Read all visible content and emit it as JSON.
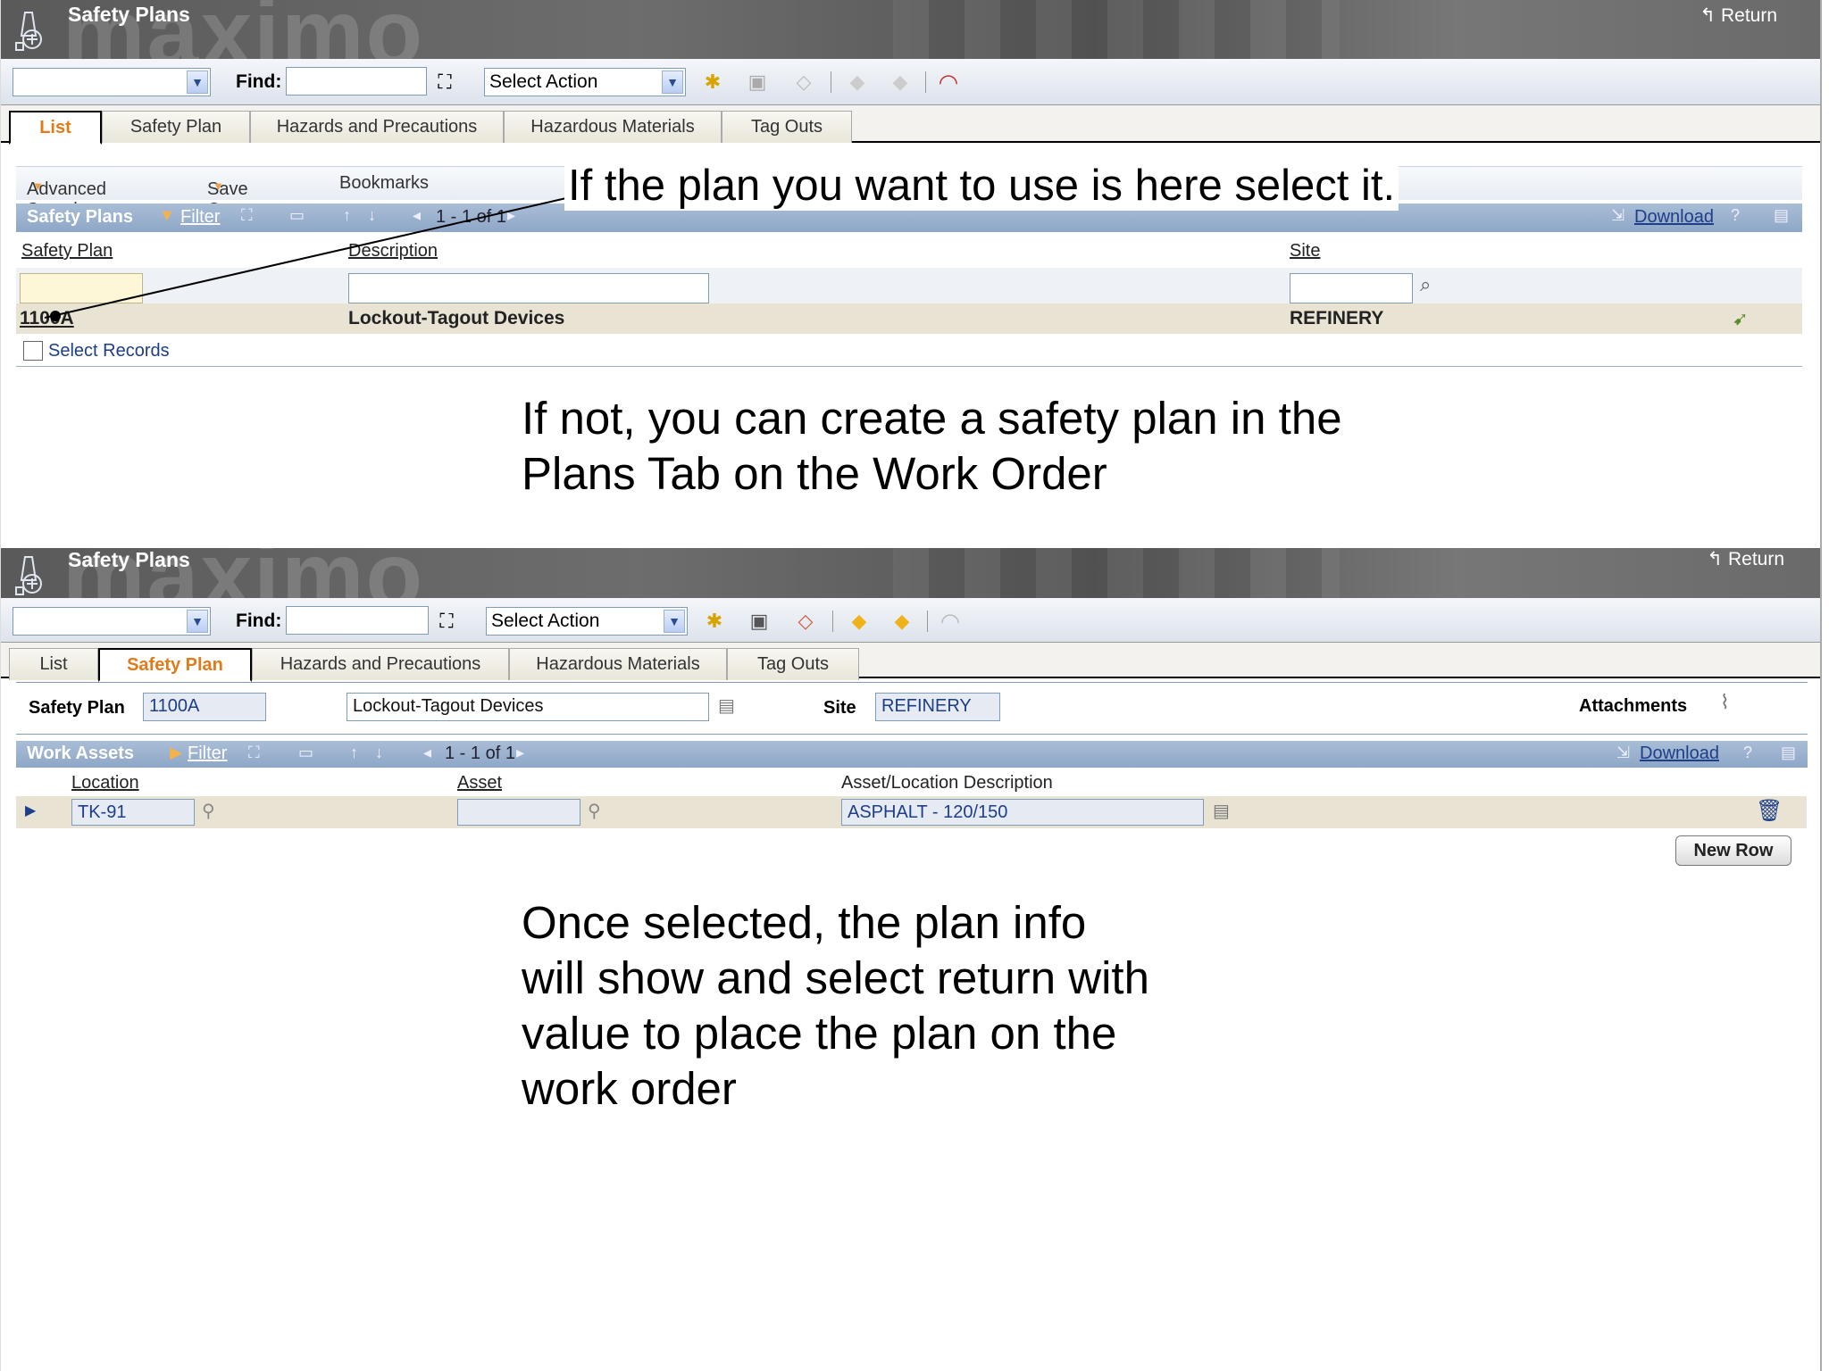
{
  "screen1": {
    "app_title": "Safety Plans",
    "watermark": "maximo",
    "return_label": "Return",
    "find_label": "Find:",
    "select_action": "Select Action",
    "tabs": [
      "List",
      "Safety Plan",
      "Hazards and Precautions",
      "Hazardous Materials",
      "Tag Outs"
    ],
    "active_tab": "List",
    "menu": {
      "advanced_search": "Advanced Search",
      "save_query": "Save Query",
      "bookmarks": "Bookmarks"
    },
    "table": {
      "name": "Safety Plans",
      "filter": "Filter",
      "paging": "1 - 1 of 1",
      "download": "Download",
      "help": "?",
      "columns": [
        "Safety Plan",
        "Description",
        "Site"
      ],
      "rows": [
        {
          "safety_plan": "1100A",
          "description": "Lockout-Tagout Devices",
          "site": "REFINERY"
        }
      ]
    },
    "select_records": "Select Records"
  },
  "screen2": {
    "app_title": "Safety Plans",
    "watermark": "maximo",
    "return_label": "Return",
    "find_label": "Find:",
    "select_action": "Select Action",
    "tabs": [
      "List",
      "Safety Plan",
      "Hazards and Precautions",
      "Hazardous Materials",
      "Tag Outs"
    ],
    "active_tab": "Safety Plan",
    "form": {
      "safety_plan_label": "Safety Plan",
      "safety_plan_value": "1100A",
      "description_value": "Lockout-Tagout Devices",
      "site_label": "Site",
      "site_value": "REFINERY",
      "attachments_label": "Attachments"
    },
    "assets_table": {
      "name": "Work Assets",
      "filter": "Filter",
      "paging": "1 - 1 of 1",
      "download": "Download",
      "help": "?",
      "columns": [
        "Location",
        "Asset",
        "Asset/Location Description"
      ],
      "rows": [
        {
          "location": "TK-91",
          "asset": "",
          "description": "ASPHALT - 120/150"
        }
      ]
    },
    "new_row": "New Row"
  },
  "annotations": {
    "a1": "If the plan you want to use is here select it.",
    "a2_line1": "If not, you can create a safety plan in the",
    "a2_line2": "Plans Tab on the Work Order",
    "a3_line1": "Once selected, the plan info",
    "a3_line2": "will show and select return with",
    "a3_line3": "value to place the plan on the",
    "a3_line4": "work order"
  },
  "colors": {
    "active_tab": "#e07b1a",
    "table_bar": "#8ea7c7",
    "row_bg": "#e8e3d2",
    "link": "#1d3e88"
  }
}
